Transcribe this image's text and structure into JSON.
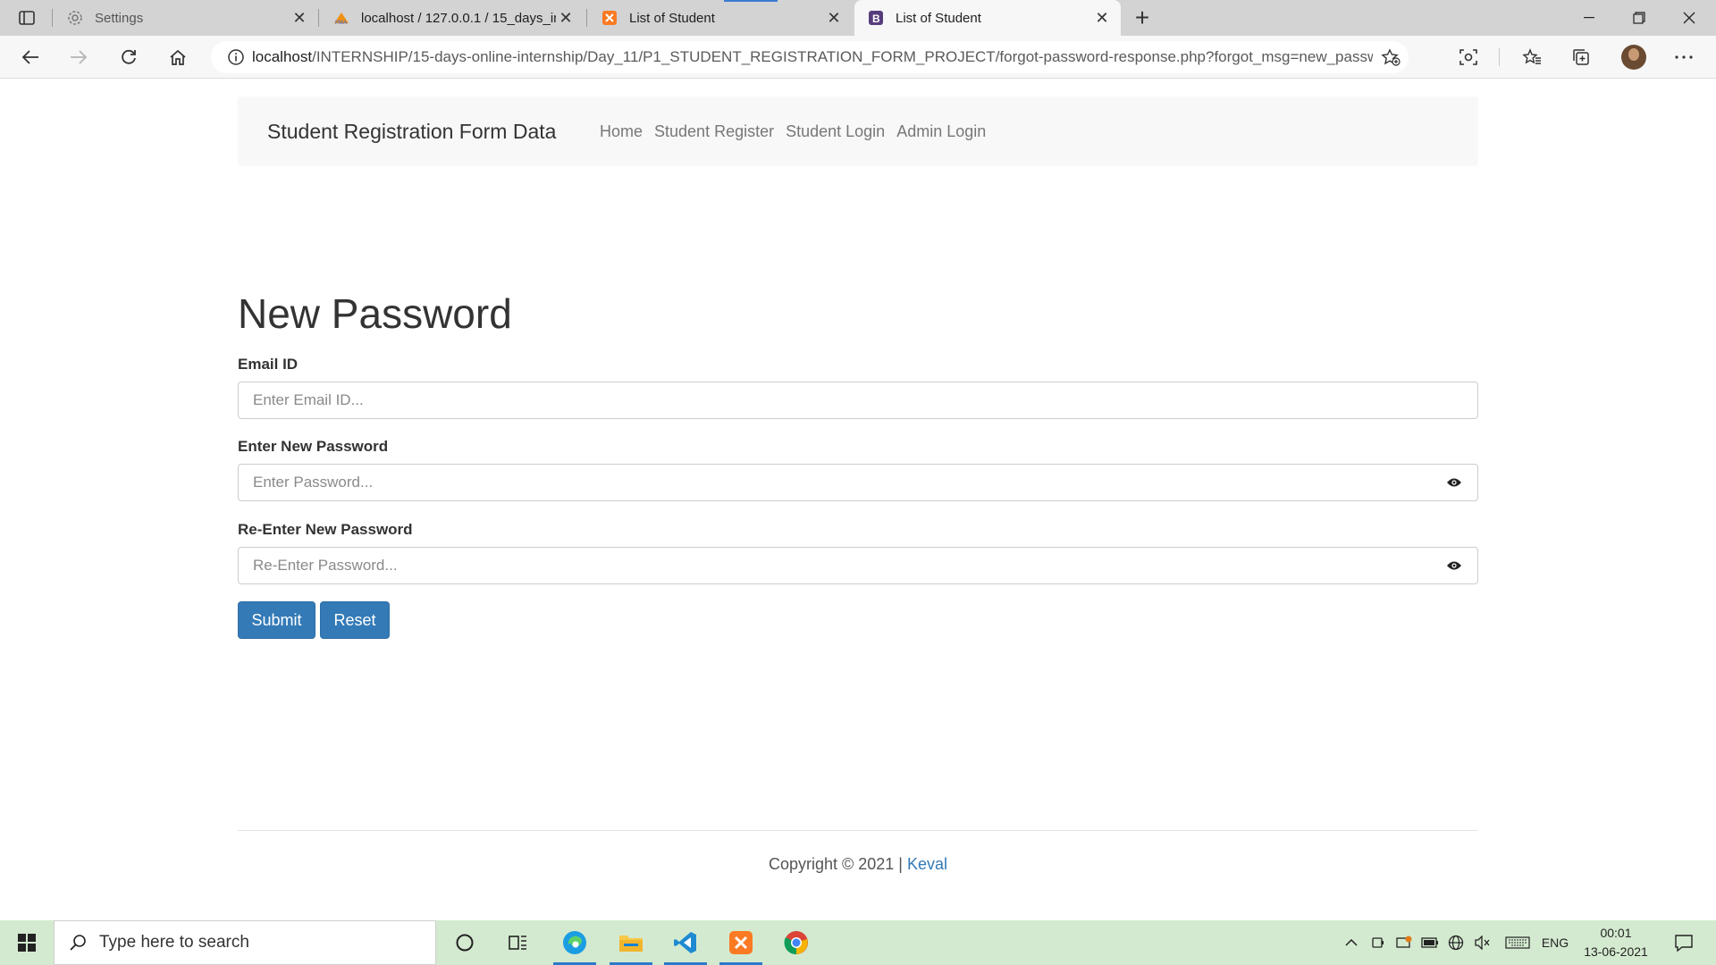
{
  "browser": {
    "tabs": [
      {
        "title": "Settings",
        "icon": "gear-icon"
      },
      {
        "title": "localhost / 127.0.0.1 / 15_days_in",
        "icon": "phpmyadmin-icon"
      },
      {
        "title": "List of Student",
        "icon": "xampp-icon"
      },
      {
        "title": "List of Student",
        "icon": "bootstrap-icon",
        "active": true
      }
    ],
    "url_host": "localhost",
    "url_rest": "/INTERNSHIP/15-days-online-internship/Day_11/P1_STUDENT_REGISTRATION_FORM_PROJECT/forgot-password-response.php?forgot_msg=new_passw..."
  },
  "navbar": {
    "brand": "Student Registration Form Data",
    "links": [
      "Home",
      "Student Register",
      "Student Login",
      "Admin Login"
    ]
  },
  "form": {
    "title": "New Password",
    "email_label": "Email ID",
    "email_placeholder": "Enter Email ID...",
    "password_label": "Enter New Password",
    "password_placeholder": "Enter Password...",
    "repassword_label": "Re-Enter New Password",
    "repassword_placeholder": "Re-Enter Password...",
    "submit_label": "Submit",
    "reset_label": "Reset"
  },
  "footer": {
    "copyright": "Copyright © 2021 |",
    "author": "Keval"
  },
  "taskbar": {
    "search_placeholder": "Type here to search",
    "language": "ENG",
    "time": "00:01",
    "date": "13-06-2021"
  },
  "colors": {
    "primary": "#337ab7",
    "taskbar": "#d4ead0",
    "navbar_bg": "#f8f8f8"
  }
}
